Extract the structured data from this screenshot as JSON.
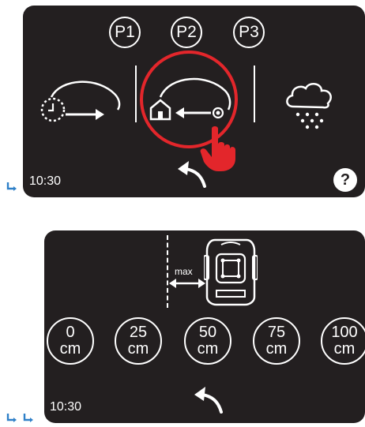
{
  "screen1": {
    "time": "10:30",
    "programs": [
      "P1",
      "P2",
      "P3"
    ],
    "help_label": "?",
    "modes": [
      {
        "icon": "timer-drive-out-icon"
      },
      {
        "icon": "return-home-icon",
        "selected": true
      },
      {
        "icon": "rain-icon"
      }
    ]
  },
  "screen2": {
    "time": "10:30",
    "max_label": "max",
    "heights": [
      {
        "value": "0",
        "unit": "cm"
      },
      {
        "value": "25",
        "unit": "cm"
      },
      {
        "value": "50",
        "unit": "cm"
      },
      {
        "value": "75",
        "unit": "cm"
      },
      {
        "value": "100",
        "unit": "cm"
      }
    ]
  },
  "colors": {
    "screen_bg": "#231f20",
    "highlight_red": "#e3262b",
    "indicator_blue": "#2f80c8"
  }
}
